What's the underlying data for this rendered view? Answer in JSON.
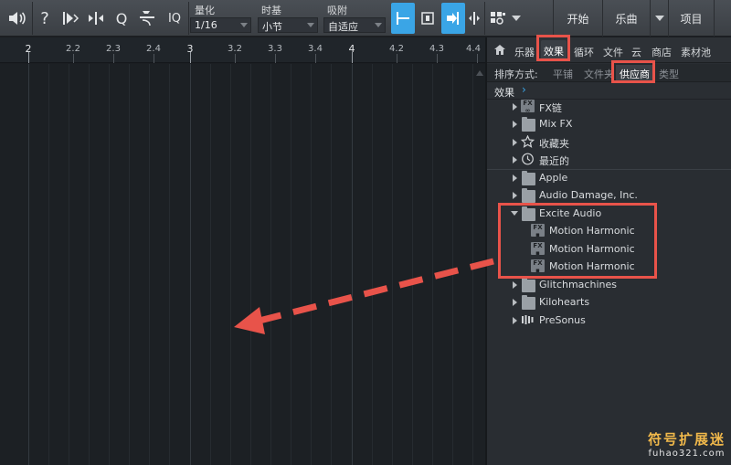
{
  "toolbar": {
    "quantize": {
      "label": "量化",
      "value": "1/16"
    },
    "timebase": {
      "label": "时基",
      "value": "小节"
    },
    "snap": {
      "label": "吸附",
      "value": "自适应"
    },
    "iq_label": "IQ",
    "q_label": "Q",
    "nav": {
      "start": "开始",
      "song": "乐曲",
      "project": "项目"
    }
  },
  "ruler": {
    "ticks": [
      "2",
      "2.2",
      "2.3",
      "2.4",
      "3",
      "3.2",
      "3.3",
      "3.4",
      "4",
      "4.2",
      "4.3",
      "4.4"
    ]
  },
  "browser": {
    "tabs": [
      "乐器",
      "效果",
      "循环",
      "文件",
      "云",
      "商店",
      "素材池"
    ],
    "active_tab": "效果",
    "sort": {
      "label": "排序方式:",
      "options": [
        "平铺",
        "文件夹",
        "供应商",
        "类型"
      ],
      "active": "供应商"
    },
    "breadcrumb": "效果",
    "tree": [
      {
        "label": "FX链",
        "icon": "fx-chain-icon"
      },
      {
        "label": "Mix FX",
        "icon": "mixfx-icon"
      },
      {
        "label": "收藏夹",
        "icon": "star-icon"
      },
      {
        "label": "最近的",
        "icon": "clock-icon"
      },
      {
        "label": "Apple",
        "icon": "folder-icon"
      },
      {
        "label": "Audio Damage, Inc.",
        "icon": "folder-icon"
      },
      {
        "label": "Excite Audio",
        "icon": "folder-open-icon"
      },
      {
        "label": "Motion Harmonic",
        "icon": "fx-plugin-icon"
      },
      {
        "label": "Motion Harmonic",
        "icon": "fx-plugin-icon"
      },
      {
        "label": "Motion Harmonic",
        "icon": "fx-plugin-icon"
      },
      {
        "label": "Glitchmachines",
        "icon": "folder-icon"
      },
      {
        "label": "Kilohearts",
        "icon": "folder-icon"
      },
      {
        "label": "PreSonus",
        "icon": "presonus-icon"
      }
    ]
  },
  "watermark": {
    "cn": "符号扩展迷",
    "en": "fuhao321.com"
  },
  "colors": {
    "accent": "#3aa5e6",
    "annotation": "#e8534a",
    "watermark": "#f0b84b"
  }
}
